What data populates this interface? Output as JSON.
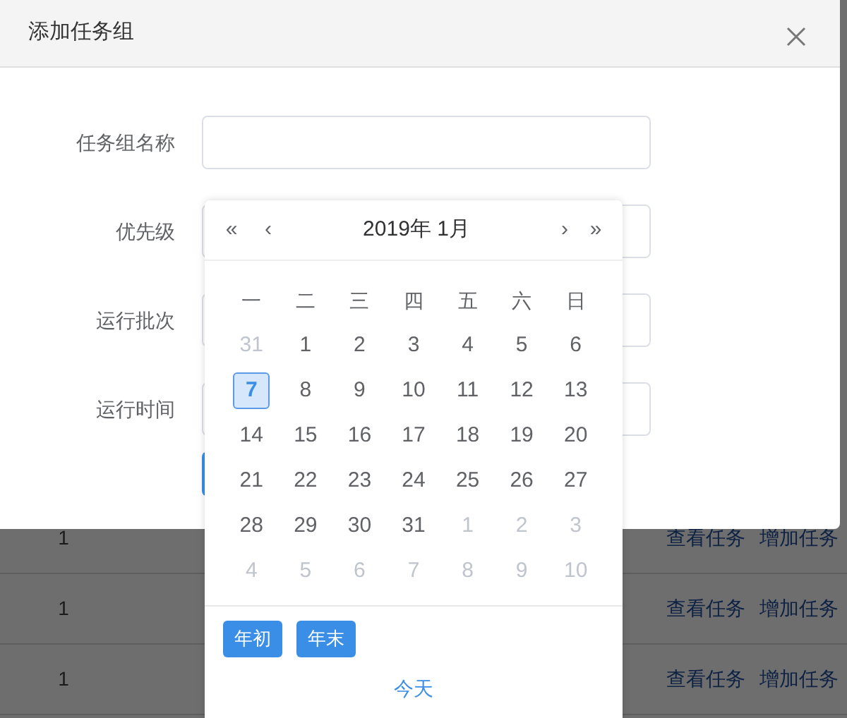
{
  "table": {
    "rows": [
      {
        "column_1": "1",
        "actions": [
          "查看任务",
          "增加任务"
        ]
      },
      {
        "column_1": "1",
        "actions": [
          "查看任务",
          "增加任务"
        ]
      },
      {
        "column_1": "1",
        "actions": [
          "查看任务",
          "增加任务"
        ]
      }
    ]
  },
  "dialog": {
    "title": "添加任务组",
    "fields": [
      {
        "label": "任务组名称"
      },
      {
        "label": "优先级"
      },
      {
        "label": "运行批次"
      },
      {
        "label": "运行时间"
      }
    ]
  },
  "date_picker": {
    "nav": [
      "«",
      "‹",
      "›",
      "»"
    ],
    "title": "2019年 1月",
    "weekdays": [
      "一",
      "二",
      "三",
      "四",
      "五",
      "六",
      "日"
    ],
    "weeks": [
      [
        {
          "day": "31",
          "muted": true,
          "selected": false
        },
        {
          "day": "1",
          "muted": false,
          "selected": false
        },
        {
          "day": "2",
          "muted": false,
          "selected": false
        },
        {
          "day": "3",
          "muted": false,
          "selected": false
        },
        {
          "day": "4",
          "muted": false,
          "selected": false
        },
        {
          "day": "5",
          "muted": false,
          "selected": false
        },
        {
          "day": "6",
          "muted": false,
          "selected": false
        }
      ],
      [
        {
          "day": "7",
          "muted": false,
          "selected": true
        },
        {
          "day": "8",
          "muted": false,
          "selected": false
        },
        {
          "day": "9",
          "muted": false,
          "selected": false
        },
        {
          "day": "10",
          "muted": false,
          "selected": false
        },
        {
          "day": "11",
          "muted": false,
          "selected": false
        },
        {
          "day": "12",
          "muted": false,
          "selected": false
        },
        {
          "day": "13",
          "muted": false,
          "selected": false
        }
      ],
      [
        {
          "day": "14",
          "muted": false,
          "selected": false
        },
        {
          "day": "15",
          "muted": false,
          "selected": false
        },
        {
          "day": "16",
          "muted": false,
          "selected": false
        },
        {
          "day": "17",
          "muted": false,
          "selected": false
        },
        {
          "day": "18",
          "muted": false,
          "selected": false
        },
        {
          "day": "19",
          "muted": false,
          "selected": false
        },
        {
          "day": "20",
          "muted": false,
          "selected": false
        }
      ],
      [
        {
          "day": "21",
          "muted": false,
          "selected": false
        },
        {
          "day": "22",
          "muted": false,
          "selected": false
        },
        {
          "day": "23",
          "muted": false,
          "selected": false
        },
        {
          "day": "24",
          "muted": false,
          "selected": false
        },
        {
          "day": "25",
          "muted": false,
          "selected": false
        },
        {
          "day": "26",
          "muted": false,
          "selected": false
        },
        {
          "day": "27",
          "muted": false,
          "selected": false
        }
      ],
      [
        {
          "day": "28",
          "muted": false,
          "selected": false
        },
        {
          "day": "29",
          "muted": false,
          "selected": false
        },
        {
          "day": "30",
          "muted": false,
          "selected": false
        },
        {
          "day": "31",
          "muted": false,
          "selected": false
        },
        {
          "day": "1",
          "muted": true,
          "selected": false
        },
        {
          "day": "2",
          "muted": true,
          "selected": false
        },
        {
          "day": "3",
          "muted": true,
          "selected": false
        }
      ],
      [
        {
          "day": "4",
          "muted": true,
          "selected": false
        },
        {
          "day": "5",
          "muted": true,
          "selected": false
        },
        {
          "day": "6",
          "muted": true,
          "selected": false
        },
        {
          "day": "7",
          "muted": true,
          "selected": false
        },
        {
          "day": "8",
          "muted": true,
          "selected": false
        },
        {
          "day": "9",
          "muted": true,
          "selected": false
        },
        {
          "day": "10",
          "muted": true,
          "selected": false
        }
      ]
    ],
    "shortcuts": [
      "年初",
      "年末"
    ],
    "today": "今天"
  }
}
